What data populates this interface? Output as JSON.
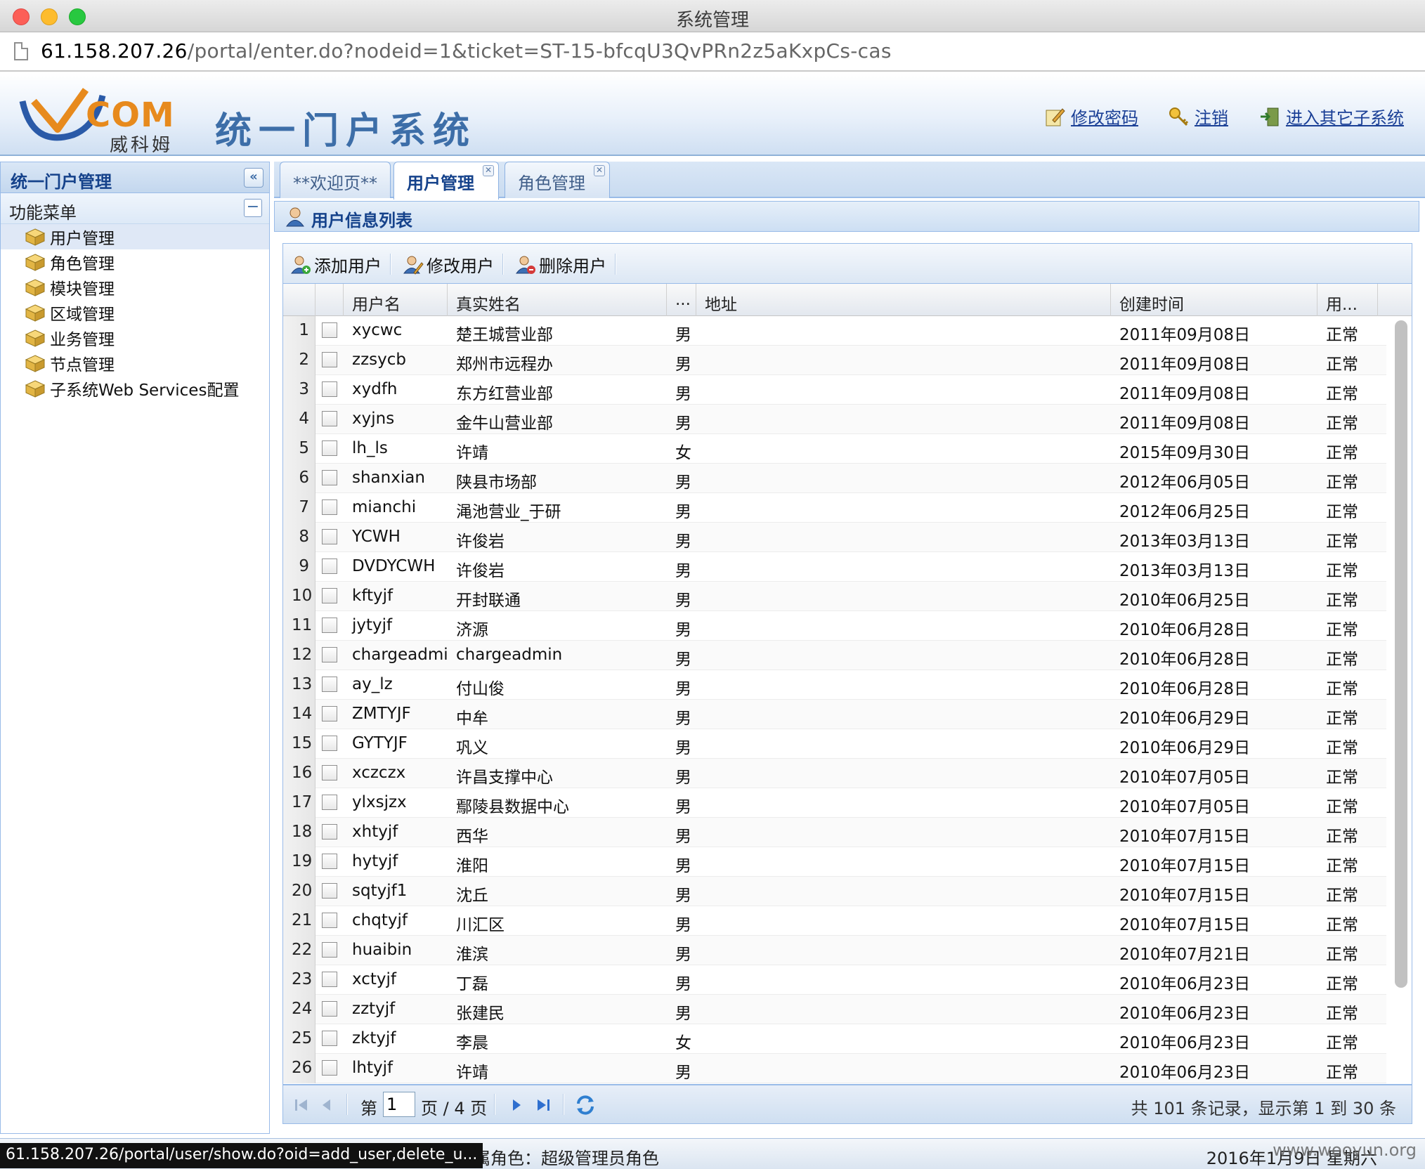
{
  "window": {
    "title": "系统管理"
  },
  "browser": {
    "url_host": "61.158.207.26",
    "url_path": "/portal/enter.do?nodeid=1&ticket=ST-15-bfcqU3QvPRn2z5aKxpCs-cas"
  },
  "header": {
    "logo_text": "COM",
    "logo_cn": "威科姆",
    "system_title": "统一门户系统",
    "links": {
      "change_password": "修改密码",
      "logout": "注销",
      "other_system": "进入其它子系统"
    }
  },
  "sidebar": {
    "title": "统一门户管理",
    "section": "功能菜单",
    "items": [
      {
        "label": "用户管理"
      },
      {
        "label": "角色管理"
      },
      {
        "label": "模块管理"
      },
      {
        "label": "区域管理"
      },
      {
        "label": "业务管理"
      },
      {
        "label": "节点管理"
      },
      {
        "label": "子系统Web Services配置"
      }
    ]
  },
  "tabs": [
    {
      "label": "**欢迎页**"
    },
    {
      "label": "用户管理"
    },
    {
      "label": "角色管理"
    }
  ],
  "panel": {
    "title": "用户信息列表"
  },
  "toolbar": {
    "add": "添加用户",
    "edit": "修改用户",
    "delete": "删除用户"
  },
  "grid": {
    "columns": {
      "username": "用户名",
      "realname": "真实姓名",
      "gender": "...",
      "address": "地址",
      "created": "创建时间",
      "status": "用..."
    },
    "rows": [
      {
        "n": "1",
        "u": "xycwc",
        "r": "楚王城营业部",
        "g": "男",
        "a": "",
        "d": "2011年09月08日",
        "s": "正常"
      },
      {
        "n": "2",
        "u": "zzsycb",
        "r": "郑州市远程办",
        "g": "男",
        "a": "",
        "d": "2011年09月08日",
        "s": "正常"
      },
      {
        "n": "3",
        "u": "xydfh",
        "r": "东方红营业部",
        "g": "男",
        "a": "",
        "d": "2011年09月08日",
        "s": "正常"
      },
      {
        "n": "4",
        "u": "xyjns",
        "r": "金牛山营业部",
        "g": "男",
        "a": "",
        "d": "2011年09月08日",
        "s": "正常"
      },
      {
        "n": "5",
        "u": "lh_ls",
        "r": "许靖",
        "g": "女",
        "a": "",
        "d": "2015年09月30日",
        "s": "正常"
      },
      {
        "n": "6",
        "u": "shanxian",
        "r": "陕县市场部",
        "g": "男",
        "a": "",
        "d": "2012年06月05日",
        "s": "正常"
      },
      {
        "n": "7",
        "u": "mianchi",
        "r": "渑池营业_于研",
        "g": "男",
        "a": "",
        "d": "2012年06月25日",
        "s": "正常"
      },
      {
        "n": "8",
        "u": "YCWH",
        "r": "许俊岩",
        "g": "男",
        "a": "",
        "d": "2013年03月13日",
        "s": "正常"
      },
      {
        "n": "9",
        "u": "DVDYCWH",
        "r": "许俊岩",
        "g": "男",
        "a": "",
        "d": "2013年03月13日",
        "s": "正常"
      },
      {
        "n": "10",
        "u": "kftyjf",
        "r": "开封联通",
        "g": "男",
        "a": "",
        "d": "2010年06月25日",
        "s": "正常"
      },
      {
        "n": "11",
        "u": "jytyjf",
        "r": "济源",
        "g": "男",
        "a": "",
        "d": "2010年06月28日",
        "s": "正常"
      },
      {
        "n": "12",
        "u": "chargeadmir",
        "r": "chargeadmin",
        "g": "男",
        "a": "",
        "d": "2010年06月28日",
        "s": "正常"
      },
      {
        "n": "13",
        "u": "ay_lz",
        "r": "付山俊",
        "g": "男",
        "a": "",
        "d": "2010年06月28日",
        "s": "正常"
      },
      {
        "n": "14",
        "u": "ZMTYJF",
        "r": "中牟",
        "g": "男",
        "a": "",
        "d": "2010年06月29日",
        "s": "正常"
      },
      {
        "n": "15",
        "u": "GYTYJF",
        "r": "巩义",
        "g": "男",
        "a": "",
        "d": "2010年06月29日",
        "s": "正常"
      },
      {
        "n": "16",
        "u": "xczczx",
        "r": "许昌支撑中心",
        "g": "男",
        "a": "",
        "d": "2010年07月05日",
        "s": "正常"
      },
      {
        "n": "17",
        "u": "ylxsjzx",
        "r": "鄢陵县数据中心",
        "g": "男",
        "a": "",
        "d": "2010年07月05日",
        "s": "正常"
      },
      {
        "n": "18",
        "u": "xhtyjf",
        "r": "西华",
        "g": "男",
        "a": "",
        "d": "2010年07月15日",
        "s": "正常"
      },
      {
        "n": "19",
        "u": "hytyjf",
        "r": "淮阳",
        "g": "男",
        "a": "",
        "d": "2010年07月15日",
        "s": "正常"
      },
      {
        "n": "20",
        "u": "sqtyjf1",
        "r": "沈丘",
        "g": "男",
        "a": "",
        "d": "2010年07月15日",
        "s": "正常"
      },
      {
        "n": "21",
        "u": "chqtyjf",
        "r": "川汇区",
        "g": "男",
        "a": "",
        "d": "2010年07月15日",
        "s": "正常"
      },
      {
        "n": "22",
        "u": "huaibin",
        "r": "淮滨",
        "g": "男",
        "a": "",
        "d": "2010年07月21日",
        "s": "正常"
      },
      {
        "n": "23",
        "u": "xctyjf",
        "r": "丁磊",
        "g": "男",
        "a": "",
        "d": "2010年06月23日",
        "s": "正常"
      },
      {
        "n": "24",
        "u": "zztyjf",
        "r": "张建民",
        "g": "男",
        "a": "",
        "d": "2010年06月23日",
        "s": "正常"
      },
      {
        "n": "25",
        "u": "zktyjf",
        "r": "李晨",
        "g": "女",
        "a": "",
        "d": "2010年06月23日",
        "s": "正常"
      },
      {
        "n": "26",
        "u": "lhtyjf",
        "r": "许靖",
        "g": "男",
        "a": "",
        "d": "2010年06月23日",
        "s": "正常"
      }
    ]
  },
  "pager": {
    "prefix": "第",
    "page": "1",
    "middle": "页 / 4 页",
    "info": "共 101 条记录，显示第 1 到 30 条"
  },
  "status": {
    "link_url": "61.158.207.26/portal/user/show.do?oid=add_user,delete_u...",
    "role": "属角色：超级管理员角色",
    "date": "2016年1月9日 星期六",
    "watermark": "www.wooyun.org"
  }
}
